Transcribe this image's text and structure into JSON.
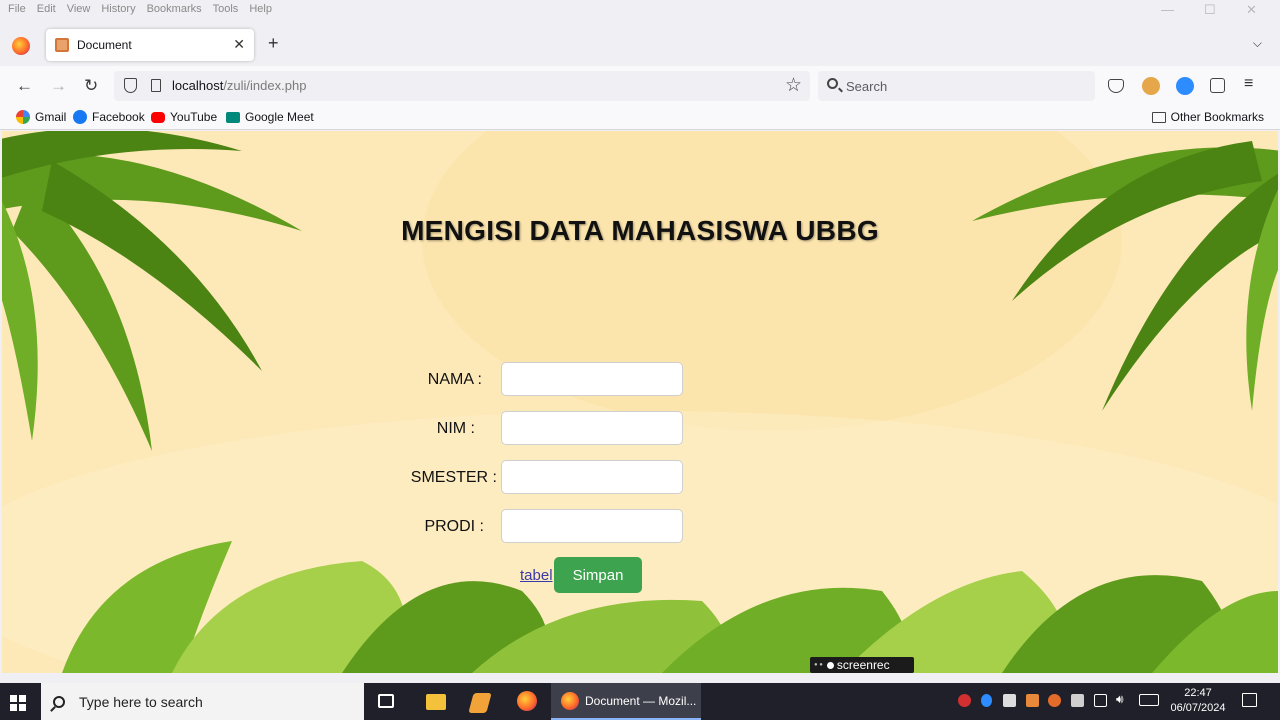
{
  "menu": [
    "File",
    "Edit",
    "View",
    "History",
    "Bookmarks",
    "Tools",
    "Help"
  ],
  "tab": {
    "title": "Document"
  },
  "nav": {
    "url_host": "localhost",
    "url_path": "/zuli/index.php",
    "search_placeholder": "Search"
  },
  "bookmarks": [
    "Gmail",
    "Facebook",
    "YouTube",
    "Google Meet"
  ],
  "other_bookmarks": "Other Bookmarks",
  "page": {
    "title": "MENGISI DATA MAHASISWA UBBG",
    "fields": [
      {
        "label": "NAMA :",
        "value": ""
      },
      {
        "label": "NIM :",
        "value": ""
      },
      {
        "label": "SMESTER :",
        "value": ""
      },
      {
        "label": "PRODI :",
        "value": ""
      }
    ],
    "link": "tabel",
    "submit": "Simpan"
  },
  "watermark": "screenrec",
  "taskbar": {
    "search_placeholder": "Type here to search",
    "active_app": "Document — Mozil...",
    "time": "22:47",
    "date": "06/07/2024"
  },
  "colors": {
    "page_bg": "#fde9b8",
    "submit_bg": "#3da34f",
    "palm": "#5e9a1c"
  }
}
